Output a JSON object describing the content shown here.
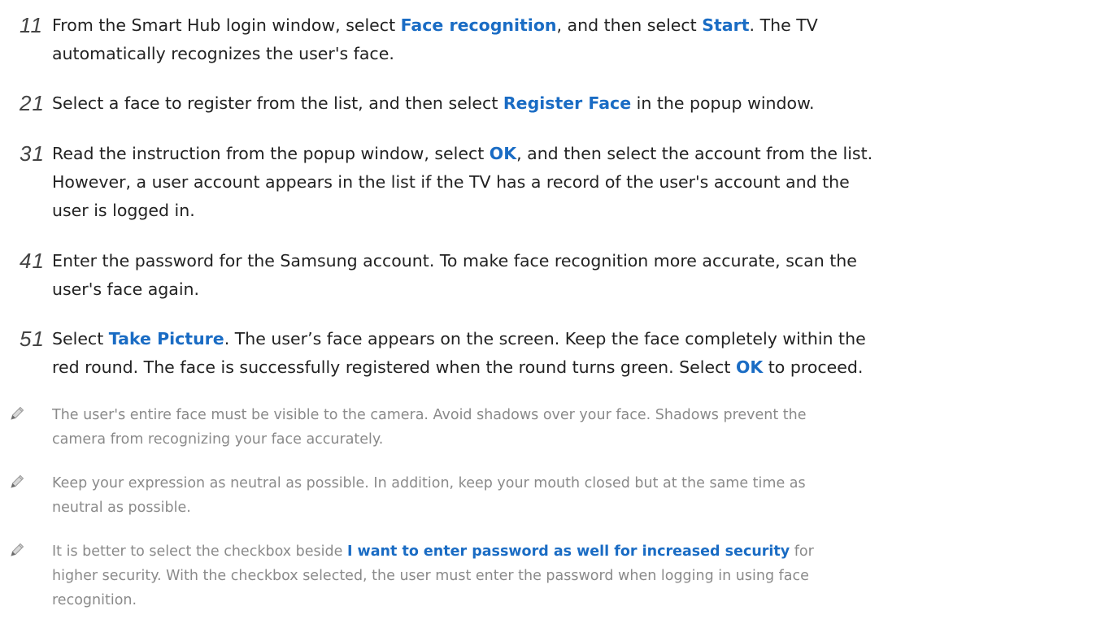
{
  "steps": [
    {
      "number": "11",
      "lines": [
        [
          {
            "text": "From the Smart Hub login window, select "
          },
          {
            "text": "Face recognition",
            "highlight": true
          },
          {
            "text": ", and then select "
          },
          {
            "text": "Start",
            "highlight": true
          },
          {
            "text": ". The TV"
          }
        ],
        [
          {
            "text": "automatically recognizes the user's face."
          }
        ]
      ]
    },
    {
      "number": "21",
      "lines": [
        [
          {
            "text": "Select a face to register from the list, and then select "
          },
          {
            "text": "Register Face",
            "highlight": true
          },
          {
            "text": " in the popup window."
          }
        ]
      ]
    },
    {
      "number": "31",
      "lines": [
        [
          {
            "text": "Read the instruction from the popup window, select "
          },
          {
            "text": "OK",
            "highlight": true
          },
          {
            "text": ", and then select the account from the list."
          }
        ],
        [
          {
            "text": "However, a user account appears in the list if the TV has a record of the user's account and the"
          }
        ],
        [
          {
            "text": "user is logged in."
          }
        ]
      ]
    },
    {
      "number": "41",
      "lines": [
        [
          {
            "text": "Enter the password for the Samsung account. To make face recognition more accurate, scan the"
          }
        ],
        [
          {
            "text": "user's face again."
          }
        ]
      ]
    },
    {
      "number": "51",
      "lines": [
        [
          {
            "text": "Select "
          },
          {
            "text": "Take Picture",
            "highlight": true
          },
          {
            "text": ". The user’s face appears on the screen. Keep the face completely within the"
          }
        ],
        [
          {
            "text": "red round. The face is successfully registered when the round turns green. Select "
          },
          {
            "text": "OK",
            "highlight": true
          },
          {
            "text": " to proceed."
          }
        ]
      ]
    }
  ],
  "notes": [
    {
      "icon": "pencil-icon",
      "lines": [
        [
          {
            "text": "The user's entire face must be visible to the camera. Avoid shadows over your face. Shadows prevent the"
          }
        ],
        [
          {
            "text": "camera from recognizing your face accurately."
          }
        ]
      ]
    },
    {
      "icon": "pencil-icon",
      "lines": [
        [
          {
            "text": "Keep your expression as neutral as possible. In addition, keep your mouth closed but at the same time as"
          }
        ],
        [
          {
            "text": "neutral as possible."
          }
        ]
      ]
    },
    {
      "icon": "pencil-icon",
      "lines": [
        [
          {
            "text": "It is better to select the checkbox beside "
          },
          {
            "text": "I want to enter password as well for increased security",
            "highlight": true
          },
          {
            "text": " for"
          }
        ],
        [
          {
            "text": "higher security. With the checkbox selected, the user must enter the password when logging in using face"
          }
        ],
        [
          {
            "text": "recognition."
          }
        ]
      ]
    }
  ],
  "colors": {
    "highlight": "#1a6cc4",
    "body_text": "#222222",
    "note_text": "#8a8a8a"
  }
}
